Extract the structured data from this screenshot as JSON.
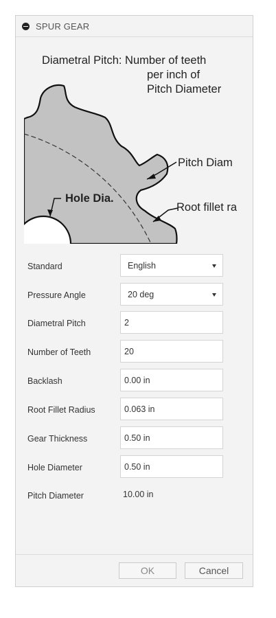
{
  "dialog": {
    "title": "SPUR GEAR",
    "collapse_icon": "minus-circle-icon"
  },
  "illustration": {
    "heading_line1": "Diametral Pitch: Number of teeth",
    "heading_line2": "per inch of",
    "heading_line3": "Pitch Diameter",
    "label_pitch_diameter": "Pitch Diam",
    "label_hole_diameter": "Hole Dia.",
    "label_root_fillet": "Root fillet ra"
  },
  "form": {
    "standard": {
      "label": "Standard",
      "value": "English"
    },
    "pressure_angle": {
      "label": "Pressure Angle",
      "value": "20 deg"
    },
    "diametral_pitch": {
      "label": "Diametral Pitch",
      "value": "2"
    },
    "number_of_teeth": {
      "label": "Number of Teeth",
      "value": "20"
    },
    "backlash": {
      "label": "Backlash",
      "value": "0.00 in"
    },
    "root_fillet_radius": {
      "label": "Root Fillet Radius",
      "value": "0.063 in"
    },
    "gear_thickness": {
      "label": "Gear Thickness",
      "value": "0.50 in"
    },
    "hole_diameter": {
      "label": "Hole Diameter",
      "value": "0.50 in"
    },
    "pitch_diameter": {
      "label": "Pitch Diameter",
      "value": "10.00 in"
    }
  },
  "buttons": {
    "ok_label": "OK",
    "cancel_label": "Cancel"
  }
}
